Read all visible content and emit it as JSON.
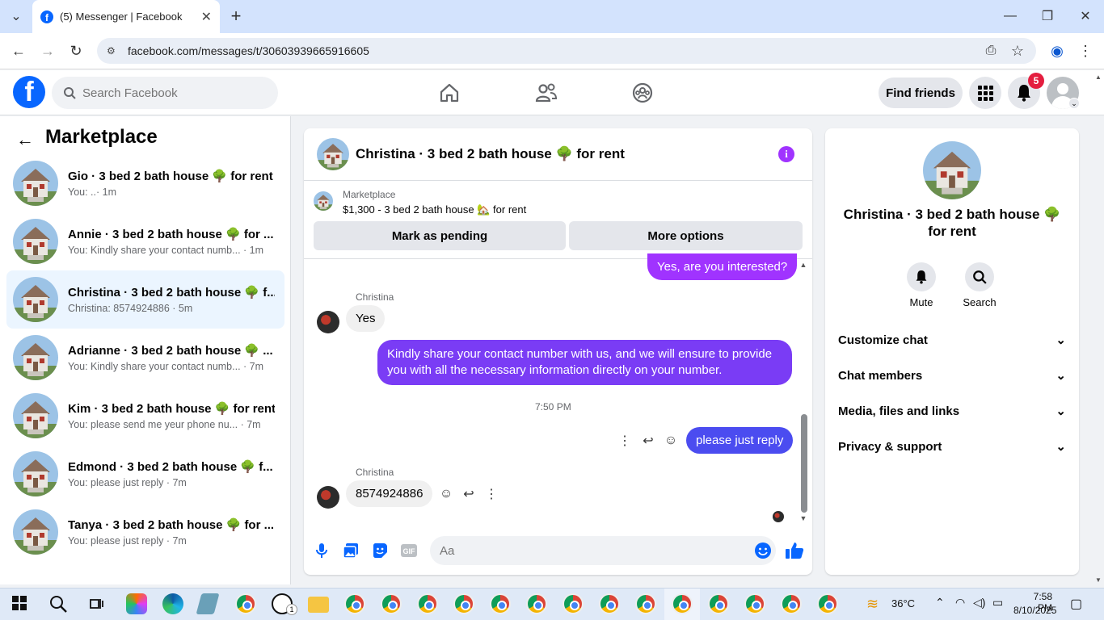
{
  "browser": {
    "tab_title": "(5) Messenger | Facebook",
    "url": "facebook.com/messages/t/30603939665916605"
  },
  "header": {
    "search_placeholder": "Search Facebook",
    "find_friends": "Find friends",
    "notification_count": "5"
  },
  "sidebar": {
    "title": "Marketplace",
    "conversations": [
      {
        "name": "Gio · 3 bed 2 bath house 🌳 for rent",
        "preview": "You: ..· 1m"
      },
      {
        "name": "Annie · 3 bed 2 bath house 🌳 for ...",
        "preview": "You: Kindly share your contact numb... · 1m"
      },
      {
        "name": "Christina · 3 bed 2 bath house 🌳 f...",
        "preview": "Christina: 8574924886 · 5m"
      },
      {
        "name": "Adrianne · 3 bed 2 bath house 🌳 ...",
        "preview": "You: Kindly share your contact numb... · 7m"
      },
      {
        "name": "Kim · 3 bed 2 bath house 🌳 for rent",
        "preview": "You: please send me yeur phone nu... · 7m"
      },
      {
        "name": "Edmond · 3 bed 2 bath house 🌳 f...",
        "preview": "You: please just reply · 7m"
      },
      {
        "name": "Tanya · 3 bed 2 bath house 🌳 for ...",
        "preview": "You: please just reply · 7m"
      }
    ]
  },
  "chat": {
    "title": "Christina · 3 bed 2 bath house 🌳 for rent",
    "marketplace_label": "Marketplace",
    "listing": "$1,300 - 3 bed 2 bath house 🏡 for rent",
    "mark_pending": "Mark as pending",
    "more_options": "More options",
    "messages": {
      "m1": "Yes, are you interested?",
      "sender1": "Christina",
      "m2": "Yes",
      "m3": "Kindly share your contact number with us, and we will ensure to provide you with all the necessary information directly on your number.",
      "time": "7:50 PM",
      "m4": "please just reply",
      "sender2": "Christina",
      "m5": "8574924886"
    },
    "composer_placeholder": "Aa"
  },
  "right_panel": {
    "name": "Christina · 3 bed 2 bath house 🌳 for rent",
    "mute": "Mute",
    "search": "Search",
    "rows": [
      "Customize chat",
      "Chat members",
      "Media, files and links",
      "Privacy & support"
    ]
  },
  "taskbar": {
    "temperature": "36°C",
    "time": "7:58 PM",
    "date": "8/10/2025"
  },
  "colors": {
    "fb_blue": "#0866ff",
    "bubble_purple": "#7b2ff7",
    "bubble_blue": "#4b4cf0",
    "badge_red": "#e41e3f"
  }
}
